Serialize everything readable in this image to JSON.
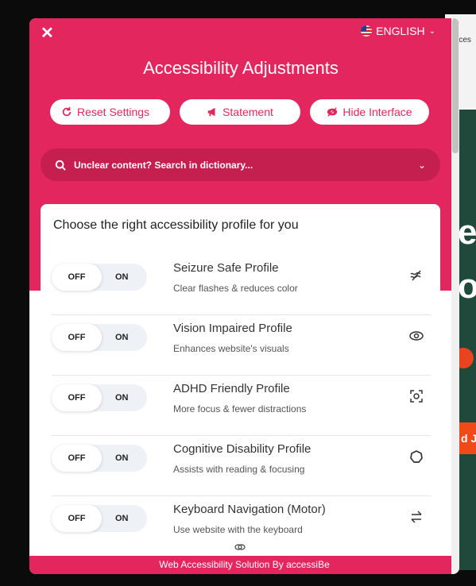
{
  "background": {
    "partial_text_top": "rces",
    "partial_text_big1": "e",
    "partial_text_big2": "o",
    "partial_button_text": "d J"
  },
  "widget": {
    "close_icon": "close-icon",
    "language": "ENGLISH",
    "title": "Accessibility Adjustments",
    "buttons": {
      "reset": "Reset Settings",
      "statement": "Statement",
      "hide": "Hide Interface"
    },
    "search": {
      "label": "Unclear content? Search in dictionary..."
    },
    "card_title": "Choose the right accessibility profile for you",
    "toggle": {
      "off": "OFF",
      "on": "ON"
    },
    "profiles": [
      {
        "name": "Seizure Safe Profile",
        "desc": "Clear flashes & reduces color",
        "icon": "wave-icon"
      },
      {
        "name": "Vision Impaired Profile",
        "desc": "Enhances website's visuals",
        "icon": "eye-icon"
      },
      {
        "name": "ADHD Friendly Profile",
        "desc": "More focus & fewer distractions",
        "icon": "focus-icon"
      },
      {
        "name": "Cognitive Disability Profile",
        "desc": "Assists with reading & focusing",
        "icon": "circle-icon"
      },
      {
        "name": "Keyboard Navigation (Motor)",
        "desc": "Use website with the keyboard",
        "icon": "arrows-icon"
      }
    ],
    "footer": "Web Accessibility Solution By accessiBe",
    "colors": {
      "accent": "#e3265e",
      "accent_dark": "#c51f50"
    }
  }
}
